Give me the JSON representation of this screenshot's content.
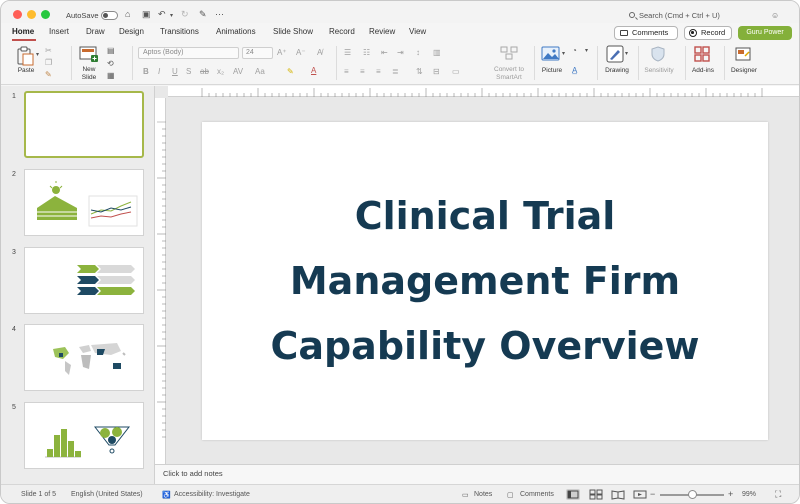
{
  "window": {
    "autosave_label": "AutoSave",
    "search_placeholder": "Search (Cmd + Ctrl + U)"
  },
  "tabs": [
    "Home",
    "Insert",
    "Draw",
    "Design",
    "Transitions",
    "Animations",
    "Slide Show",
    "Record",
    "Review",
    "View"
  ],
  "actions": {
    "comments": "Comments",
    "record": "Record",
    "guru": "Guru Power"
  },
  "ribbon": {
    "paste": "Paste",
    "new_slide_1": "New",
    "new_slide_2": "Slide",
    "font_name": "Aptos (Body)",
    "font_size": "24",
    "convert_1": "Convert to",
    "convert_2": "SmartArt",
    "picture": "Picture",
    "drawing": "Drawing",
    "sensitivity": "Sensitivity",
    "addins": "Add-ins",
    "designer": "Designer"
  },
  "thumbnails": [
    "1",
    "2",
    "3",
    "4",
    "5"
  ],
  "slide": {
    "title_lines": [
      "Clinical Trial",
      "Management Firm",
      "Capability Overview"
    ]
  },
  "notes_placeholder": "Click to add notes",
  "status": {
    "slide_of": "Slide 1 of 5",
    "language": "English (United States)",
    "accessibility": "Accessibility: Investigate",
    "notes": "Notes",
    "comments": "Comments",
    "zoom": "99%"
  },
  "colors": {
    "title": "#153a52",
    "accent_green": "#84b03a",
    "slide_dark": "#1e4a63"
  }
}
